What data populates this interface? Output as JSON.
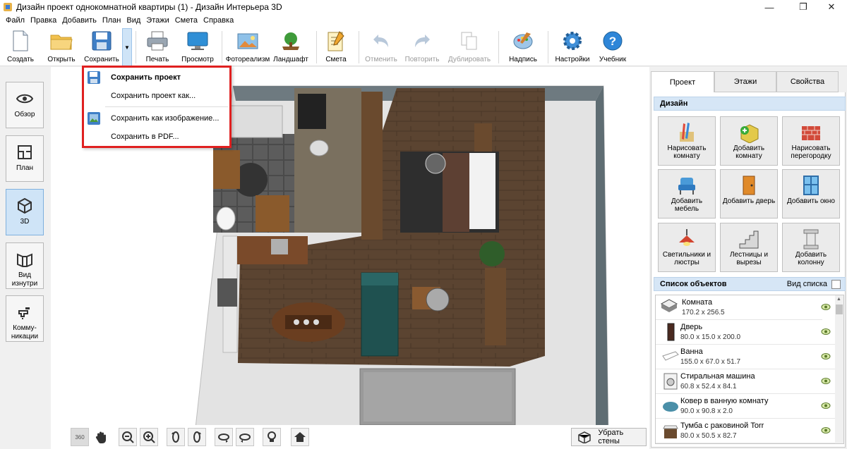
{
  "window": {
    "title": "Дизайн проект однокомнатной квартиры (1) - Дизайн Интерьера 3D"
  },
  "menu": [
    "Файл",
    "Правка",
    "Добавить",
    "План",
    "Вид",
    "Этажи",
    "Смета",
    "Справка"
  ],
  "toolbar": {
    "create": "Создать",
    "open": "Открыть",
    "save": "Сохранить",
    "print": "Печать",
    "preview": "Просмотр",
    "photoreal": "Фотореализм",
    "landscape": "Ландшафт",
    "estimate": "Смета",
    "undo": "Отменить",
    "redo": "Повторить",
    "duplicate": "Дублировать",
    "label": "Надпись",
    "settings": "Настройки",
    "tutorial": "Учебник"
  },
  "save_menu": {
    "save_project": "Сохранить проект",
    "save_project_as": "Сохранить проект как...",
    "save_as_image": "Сохранить как изображение...",
    "save_pdf": "Сохранить в  PDF..."
  },
  "left_panel": {
    "overview": "Обзор",
    "plan": "План",
    "view3d": "3D",
    "inside": "Вид изнутри",
    "comms": "Комму-никации"
  },
  "bottom": {
    "remove_walls": "Убрать стены",
    "rotate360": "360"
  },
  "right_panel": {
    "tabs": [
      "Проект",
      "Этажи",
      "Свойства"
    ],
    "design_header": "Дизайн",
    "design_buttons": [
      "Нарисовать комнату",
      "Добавить комнату",
      "Нарисовать перегородку",
      "Добавить мебель",
      "Добавить дверь",
      "Добавить окно",
      "Светильники и люстры",
      "Лестницы и вырезы",
      "Добавить колонну"
    ],
    "objects_header": "Список объектов",
    "list_view": "Вид списка",
    "objects": [
      {
        "name": "Комната",
        "dims": "170.2 x 256.5"
      },
      {
        "name": "Дверь",
        "dims": "80.0 x 15.0 x 200.0"
      },
      {
        "name": "Ванна",
        "dims": "155.0 x 67.0 x 51.7"
      },
      {
        "name": "Стиральная машина",
        "dims": "60.8 x 52.4 x 84.1"
      },
      {
        "name": "Ковер в ванную комнату",
        "dims": "90.0 x 90.8 x 2.0"
      },
      {
        "name": "Тумба с раковиной Torr",
        "dims": "80.0 x 50.5 x 82.7"
      }
    ]
  },
  "colors": {
    "accent_red": "#e02020",
    "selected_blue": "#cfe4f7",
    "header_blue": "#d6e6f6"
  }
}
